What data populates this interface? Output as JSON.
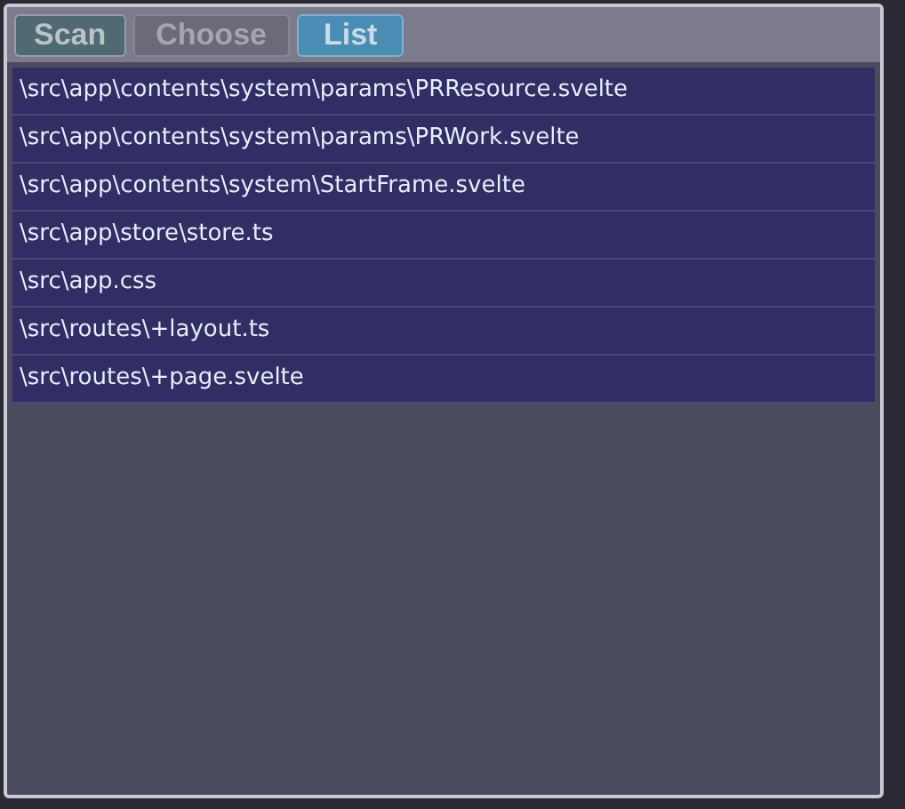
{
  "toolbar": {
    "buttons": [
      {
        "label": "Scan",
        "selected": false,
        "disabled": false
      },
      {
        "label": "Choose",
        "selected": false,
        "disabled": true
      },
      {
        "label": "List",
        "selected": true,
        "disabled": false
      }
    ]
  },
  "files": [
    {
      "path": "\\src\\app\\contents\\system\\params\\PRResource.svelte"
    },
    {
      "path": "\\src\\app\\contents\\system\\params\\PRWork.svelte"
    },
    {
      "path": "\\src\\app\\contents\\system\\StartFrame.svelte"
    },
    {
      "path": "\\src\\app\\store\\store.ts"
    },
    {
      "path": "\\src\\app.css"
    },
    {
      "path": "\\src\\routes\\+layout.ts"
    },
    {
      "path": "\\src\\routes\\+page.svelte"
    }
  ]
}
